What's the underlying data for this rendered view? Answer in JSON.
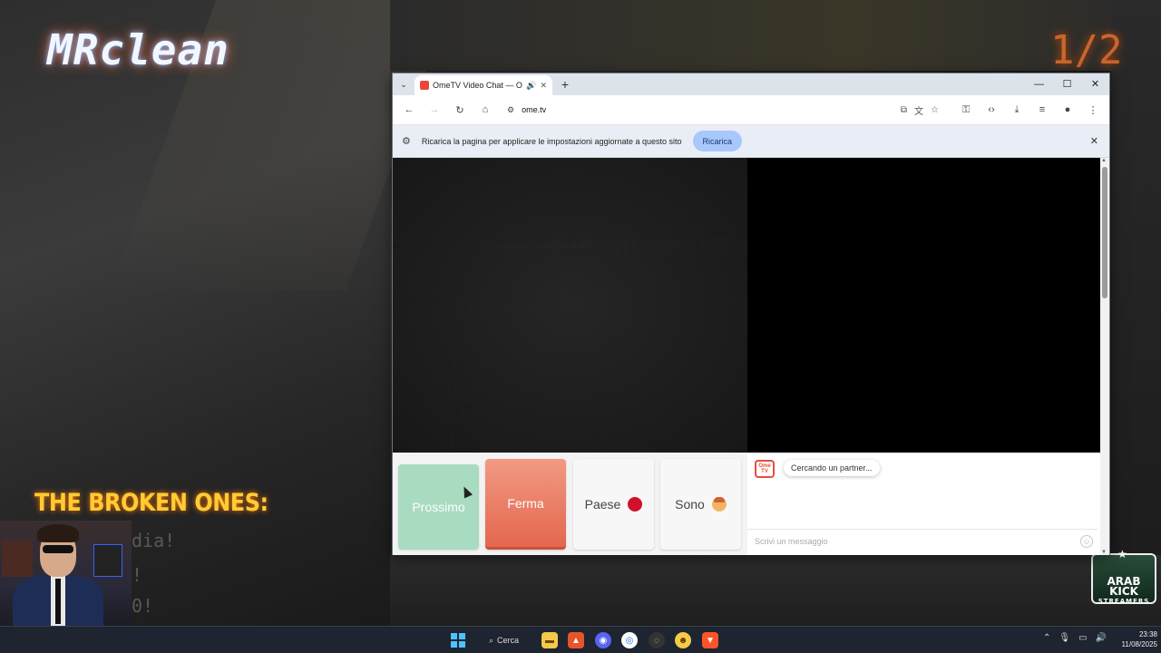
{
  "overlay": {
    "logo": "MRclean",
    "counter": "1/2",
    "broken_title": "THE BROKEN ONES:",
    "broken_lines": [
      "dia!",
      "!",
      "0!"
    ],
    "badge_main": "ARAB KICK",
    "badge_sub": "STREAMERS"
  },
  "browser": {
    "tab_title": "OmeTV Video Chat — Ome",
    "url": "ome.tv",
    "infobar_text": "Ricarica la pagina per applicare le impostazioni aggiornate a questo sito",
    "infobar_button": "Ricarica"
  },
  "ometv": {
    "next_label": "Prossimo",
    "stop_label": "Ferma",
    "country_label": "Paese",
    "gender_label": "Sono",
    "logo_text": "Ome TV",
    "status_message": "Cercando un partner...",
    "chat_placeholder": "Scrivi un messaggio"
  },
  "taskbar": {
    "search_label": "Cerca",
    "time": "23:38",
    "date": "11/08/2025"
  },
  "colors": {
    "stop_button": "#e4664f",
    "next_button": "#9dd7b8",
    "infobar_button": "#a8c7fa",
    "logo_glow": "#6fb7ff",
    "counter": "#ff7a2e",
    "broken_title": "#ffcc33"
  }
}
